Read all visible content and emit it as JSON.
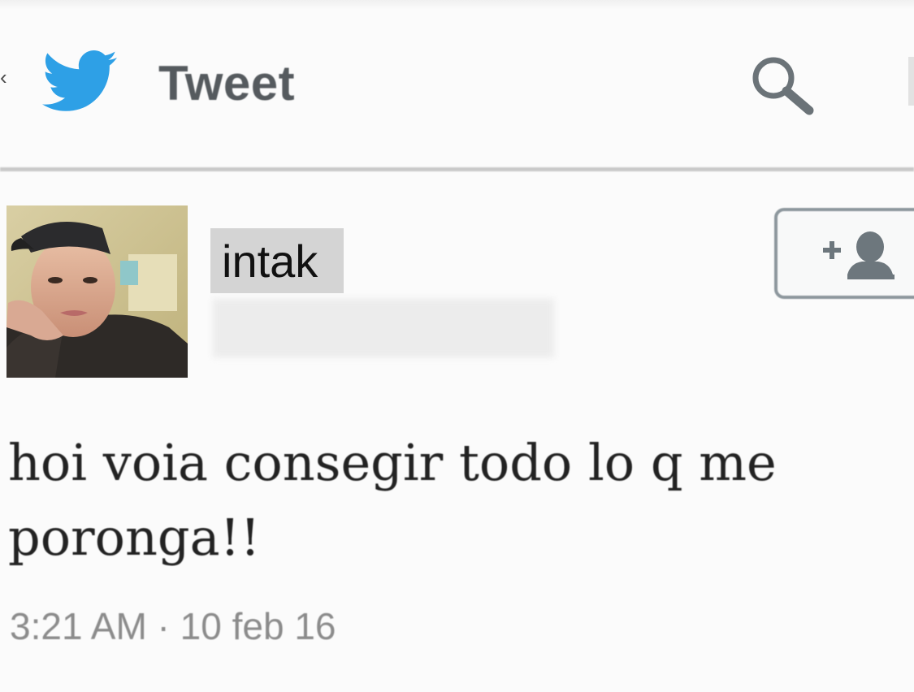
{
  "header": {
    "back_icon": "chevron-left-icon",
    "logo_icon": "twitter-bird-icon",
    "title": "Tweet",
    "search_icon": "search-icon",
    "accent_color": "#1da1f2"
  },
  "tweet": {
    "author": {
      "display_name": "intak",
      "avatar_icon": "user-photo"
    },
    "follow_icon": "add-user-icon",
    "text": "hoi voia consegir todo lo q me poronga!!",
    "timestamp": "3:21 AM · 10 feb 16"
  }
}
